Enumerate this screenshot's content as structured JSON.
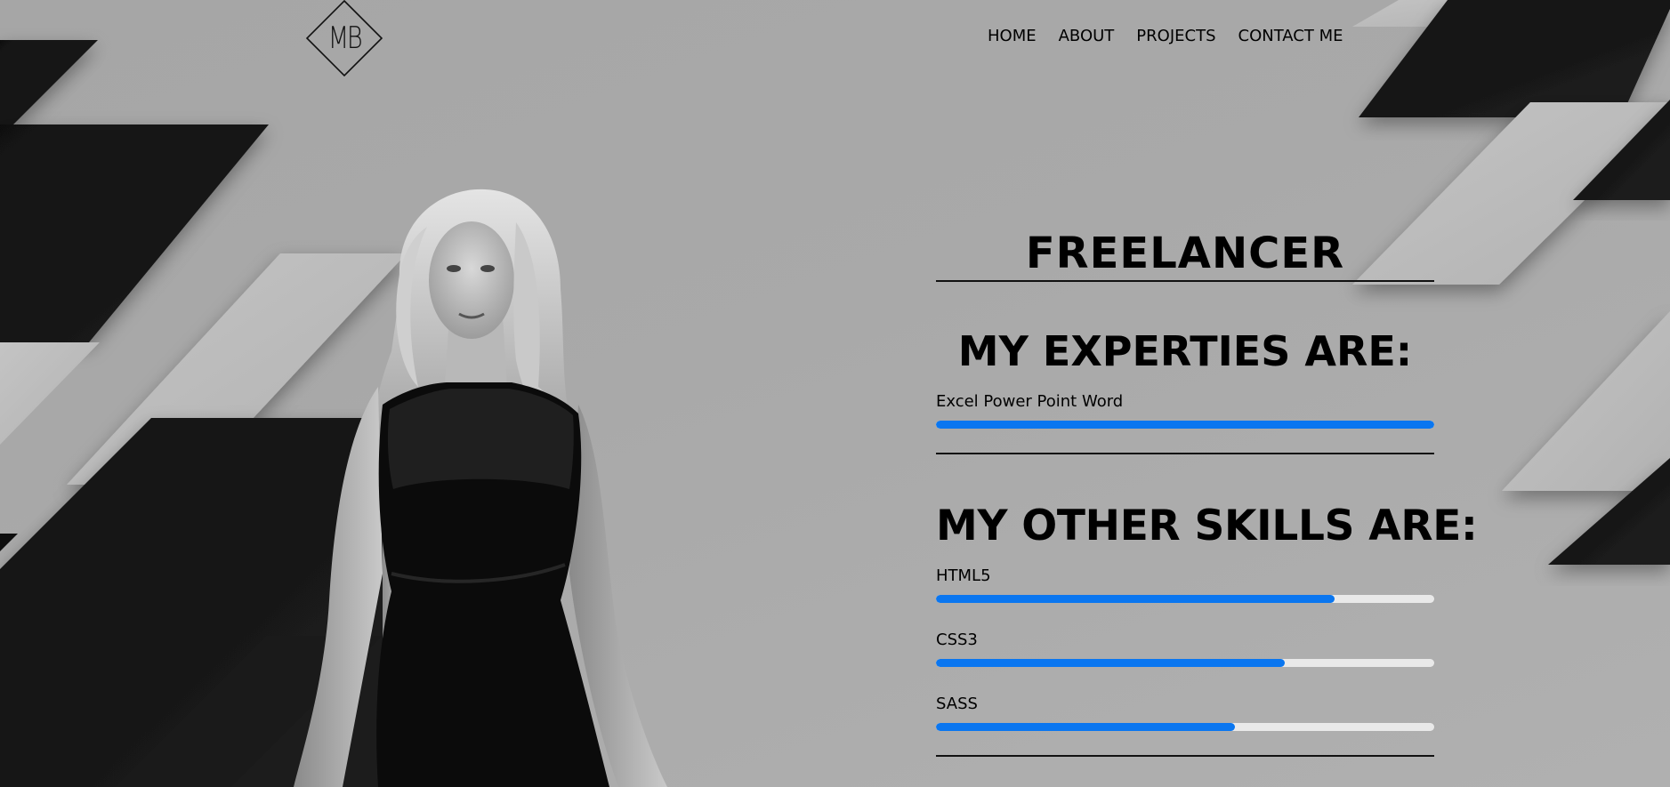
{
  "logo": {
    "text": "MB"
  },
  "nav": {
    "items": [
      "HOME",
      "ABOUT",
      "PROJECTS",
      "CONTACT ME"
    ]
  },
  "hero": {
    "title": "FREELANCER",
    "expertise_heading": "MY EXPERTIES ARE:",
    "expertise": [
      {
        "label": "Excel Power Point Word",
        "level": 1.0
      }
    ],
    "skills_heading": "MY OTHER SKILLS ARE:",
    "skills": [
      {
        "label": "HTML5",
        "level": 0.8
      },
      {
        "label": "CSS3",
        "level": 0.7
      },
      {
        "label": "SASS",
        "level": 0.6
      }
    ]
  },
  "colors": {
    "accent": "#0a76f0",
    "track": "#e9e9e9",
    "background": "#a9a9a9",
    "dark_shape": "#141414",
    "light_shape": "#bdbdbd"
  },
  "icons": {
    "logo": "diamond-monogram-icon"
  }
}
